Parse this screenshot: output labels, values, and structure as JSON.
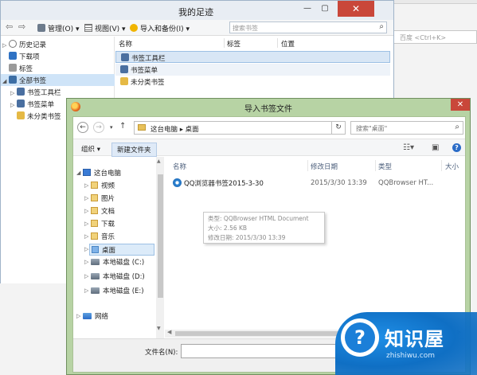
{
  "background": {
    "search_placeholder": "百度 <Ctrl+K>"
  },
  "library": {
    "title": "我的足迹",
    "close_glyph": "✕",
    "toolbar": {
      "manage": "管理(O) ▾",
      "view": "视图(V) ▾",
      "import_backup": "导入和备份(I) ▾",
      "search_placeholder": "搜索书签"
    },
    "tree": [
      {
        "label": "历史记录",
        "twisty": "▷"
      },
      {
        "label": "下载项",
        "twisty": ""
      },
      {
        "label": "标签",
        "twisty": ""
      },
      {
        "label": "全部书签",
        "twisty": "◢"
      },
      {
        "label": "书签工具栏",
        "twisty": "▷"
      },
      {
        "label": "书签菜单",
        "twisty": "▷"
      },
      {
        "label": "未分类书签",
        "twisty": ""
      }
    ],
    "columns": [
      "名称",
      "标签",
      "位置"
    ],
    "bookmarks": [
      {
        "label": "书签工具栏"
      },
      {
        "label": "书签菜单"
      },
      {
        "label": "未分类书签"
      }
    ]
  },
  "dialog": {
    "title": "导入书签文件",
    "close_glyph": "✕",
    "address": "这台电脑 ▸ 桌面",
    "search_placeholder": "搜索\"桌面\"",
    "organize": "组织 ▾",
    "new_folder": "新建文件夹",
    "nav": [
      {
        "label": "这台电脑",
        "type": "pc"
      },
      {
        "label": "视频",
        "type": "folder"
      },
      {
        "label": "图片",
        "type": "folder"
      },
      {
        "label": "文档",
        "type": "folder"
      },
      {
        "label": "下载",
        "type": "folder"
      },
      {
        "label": "音乐",
        "type": "folder"
      },
      {
        "label": "桌面",
        "type": "folder"
      },
      {
        "label": "本地磁盘 (C:)",
        "type": "drive"
      },
      {
        "label": "本地磁盘 (D:)",
        "type": "drive"
      },
      {
        "label": "本地磁盘 (E:)",
        "type": "drive"
      },
      {
        "label": "网络",
        "type": "network"
      }
    ],
    "columns": [
      "名称",
      "修改日期",
      "类型",
      "大小"
    ],
    "files": [
      {
        "name": "QQ浏览器书签2015-3-30",
        "date": "2015/3/30 13:39",
        "type": "QQBrowser HT..."
      }
    ],
    "tooltip": {
      "type_line": "类型: QQBrowser HTML Document",
      "size_line": "大小: 2.56 KB",
      "date_line": "修改日期: 2015/3/30 13:39"
    },
    "filename_label": "文件名(N):",
    "filename_value": ""
  },
  "watermark": {
    "brand": "知识屋",
    "url": "zhishiwu.com",
    "icon_glyph": "?"
  }
}
